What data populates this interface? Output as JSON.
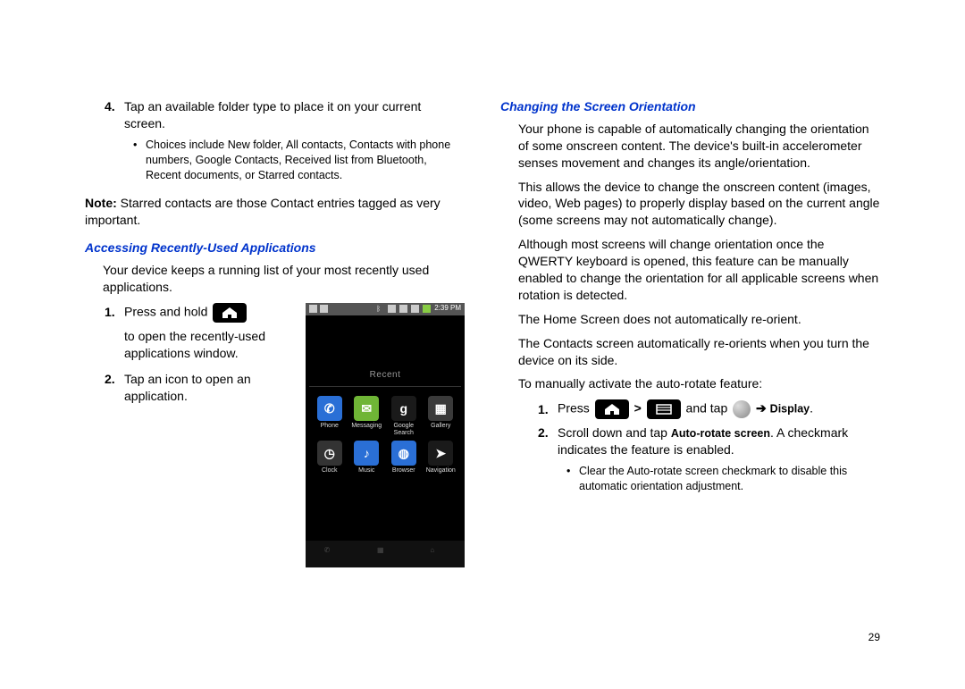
{
  "pageNumber": "29",
  "left": {
    "step4": {
      "num": "4.",
      "text": "Tap an available folder type to place it on your current screen.",
      "bullet": "Choices include New folder, All contacts, Contacts with phone numbers, Google Contacts, Received list from Bluetooth, Recent documents, or Starred contacts."
    },
    "note": {
      "label": "Note:",
      "text": "Starred contacts are those Contact entries tagged as very important."
    },
    "heading1": "Accessing Recently-Used Applications",
    "intro1": "Your device keeps a running list of your most recently used applications.",
    "s1": {
      "num": "1.",
      "a": "Press and hold",
      "b": "to open the recently-used applications window."
    },
    "s2": {
      "num": "2.",
      "text": "Tap an icon to open an application."
    },
    "phone": {
      "time": "2:39 PM",
      "recent": "Recent",
      "apps": [
        {
          "label": "Phone",
          "bg": "#2a6fd6",
          "glyph": "✆"
        },
        {
          "label": "Messaging",
          "bg": "#6fb536",
          "glyph": "✉"
        },
        {
          "label": "Google Search",
          "bg": "#1a1a1a",
          "glyph": "g"
        },
        {
          "label": "Gallery",
          "bg": "#3a3a3a",
          "glyph": "▦"
        },
        {
          "label": "Clock",
          "bg": "#333333",
          "glyph": "◷"
        },
        {
          "label": "Music",
          "bg": "#2a6fd6",
          "glyph": "♪"
        },
        {
          "label": "Browser",
          "bg": "#2a6fd6",
          "glyph": "◍"
        },
        {
          "label": "Navigation",
          "bg": "#1a1a1a",
          "glyph": "➤"
        }
      ]
    }
  },
  "right": {
    "heading": "Changing the Screen Orientation",
    "p1": "Your phone is capable of automatically changing the orientation of some onscreen content. The device's built-in accelerometer senses movement and changes its angle/orientation.",
    "p2": "This allows the device to change the onscreen content (images, video, Web pages) to properly display based on the current angle (some screens may not automatically change).",
    "p3": "Although most screens will change orientation once the QWERTY keyboard is opened, this feature can be manually enabled to change the orientation for all applicable screens when rotation is detected.",
    "p4": "The Home Screen does not automatically re-orient.",
    "p5": "The Contacts screen automatically re-orients when you turn the device on its side.",
    "p6": "To manually activate the auto-rotate feature:",
    "s1": {
      "num": "1.",
      "a": "Press",
      "gt": ">",
      "b": "and tap",
      "arrow": "➔",
      "display": "Display",
      "dot": "."
    },
    "s2": {
      "num": "2.",
      "a": "Scroll down and tap ",
      "bold": "Auto-rotate screen",
      "b": ". A checkmark indicates the feature is enabled."
    },
    "bullet": "Clear the Auto-rotate screen checkmark to disable this automatic orientation adjustment."
  }
}
